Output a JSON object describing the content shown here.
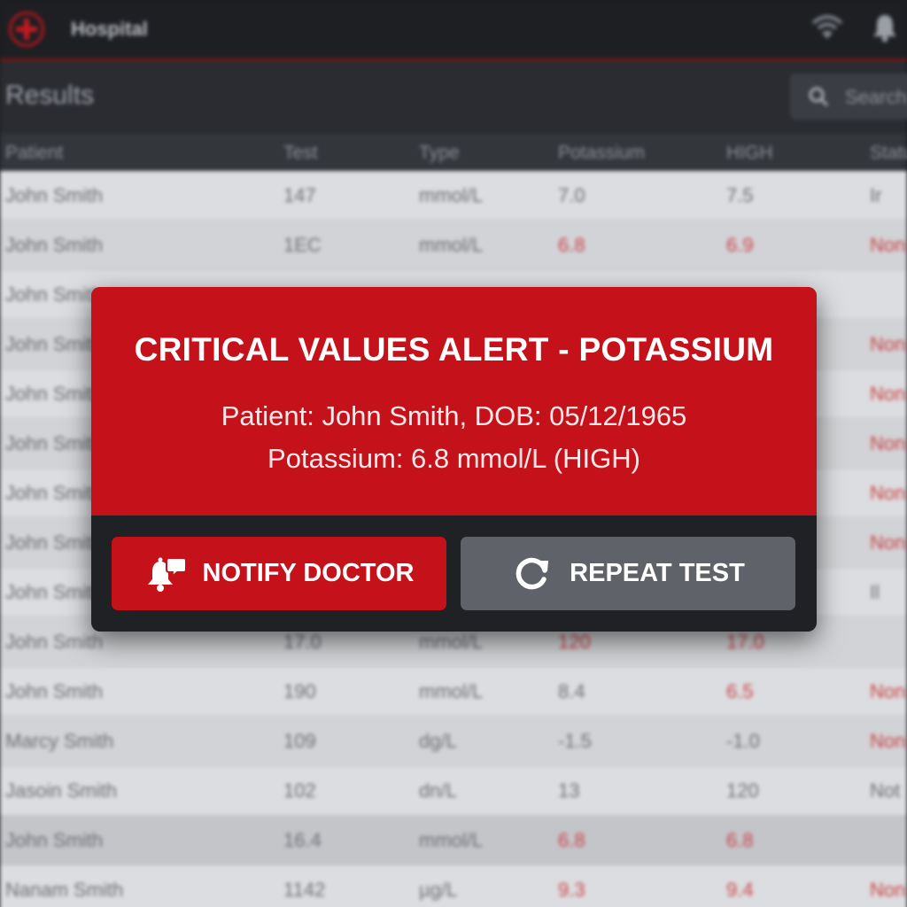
{
  "header": {
    "brand": "Hospital"
  },
  "results": {
    "title": "Results",
    "search_placeholder": "Search"
  },
  "table": {
    "columns": [
      "Patient",
      "Test",
      "Type",
      "Potassium",
      "HIGH",
      "Status"
    ],
    "rows": [
      {
        "patient": "John Smith",
        "test": "147",
        "type": "mmol/L",
        "potassium": "7.0",
        "high": "7.5",
        "status": "Ir"
      },
      {
        "patient": "John Smith",
        "test": "1EC",
        "type": "mmol/L",
        "potassium": "6.8",
        "high": "6.9",
        "status": "Non"
      },
      {
        "patient": "John Smith",
        "test": "",
        "type": "",
        "potassium": "",
        "high": "",
        "status": ""
      },
      {
        "patient": "John Smith",
        "test": "",
        "type": "",
        "potassium": "",
        "high": "",
        "status": "Non"
      },
      {
        "patient": "John Smith",
        "test": "",
        "type": "",
        "potassium": "",
        "high": "",
        "status": "Non"
      },
      {
        "patient": "John Smith",
        "test": "",
        "type": "",
        "potassium": "",
        "high": "",
        "status": "Non"
      },
      {
        "patient": "John Smith",
        "test": "",
        "type": "",
        "potassium": "",
        "high": "",
        "status": "Non"
      },
      {
        "patient": "John Smith",
        "test": "",
        "type": "",
        "potassium": "",
        "high": "",
        "status": "Non"
      },
      {
        "patient": "John Smith",
        "test": "",
        "type": "",
        "potassium": "",
        "high": "",
        "status": "Il"
      },
      {
        "patient": "John Smith",
        "test": "17.0",
        "type": "mmol/L",
        "potassium": "120",
        "high": "17.0",
        "status": ""
      },
      {
        "patient": "John Smith",
        "test": "190",
        "type": "mmol/L",
        "potassium": "8.4",
        "high": "6.5",
        "status": "Non"
      },
      {
        "patient": "Marcy Smith",
        "test": "109",
        "type": "dg/L",
        "potassium": "-1.5",
        "high": "-1.0",
        "status": "Non"
      },
      {
        "patient": "Jasoin Smith",
        "test": "102",
        "type": "dn/L",
        "potassium": "13",
        "high": "120",
        "status": "Not"
      },
      {
        "patient": "John Smith",
        "test": "16.4",
        "type": "mmol/L",
        "potassium": "6.8",
        "high": "6.8",
        "status": ""
      },
      {
        "patient": "Nanam Smith",
        "test": "1142",
        "type": "µg/L",
        "potassium": "9.3",
        "high": "9.4",
        "status": "Non"
      }
    ]
  },
  "alert": {
    "title": "CRITICAL VALUES ALERT - POTASSIUM",
    "patient_line": "Patient: John Smith, DOB: 05/12/1965",
    "value_line": "Potassium: 6.8 mmol/L (HIGH)",
    "notify_label": "NOTIFY DOCTOR",
    "repeat_label": "REPEAT TEST"
  },
  "colors": {
    "alert_red": "#c5121a",
    "secondary_button": "#5f6268",
    "critical_text": "#c8434a"
  },
  "icons": {
    "logo": "red-cross-icon",
    "wifi": "wifi-icon",
    "notifications": "bell-icon",
    "search": "search-icon",
    "notify": "bell-chat-icon",
    "repeat": "refresh-icon"
  }
}
